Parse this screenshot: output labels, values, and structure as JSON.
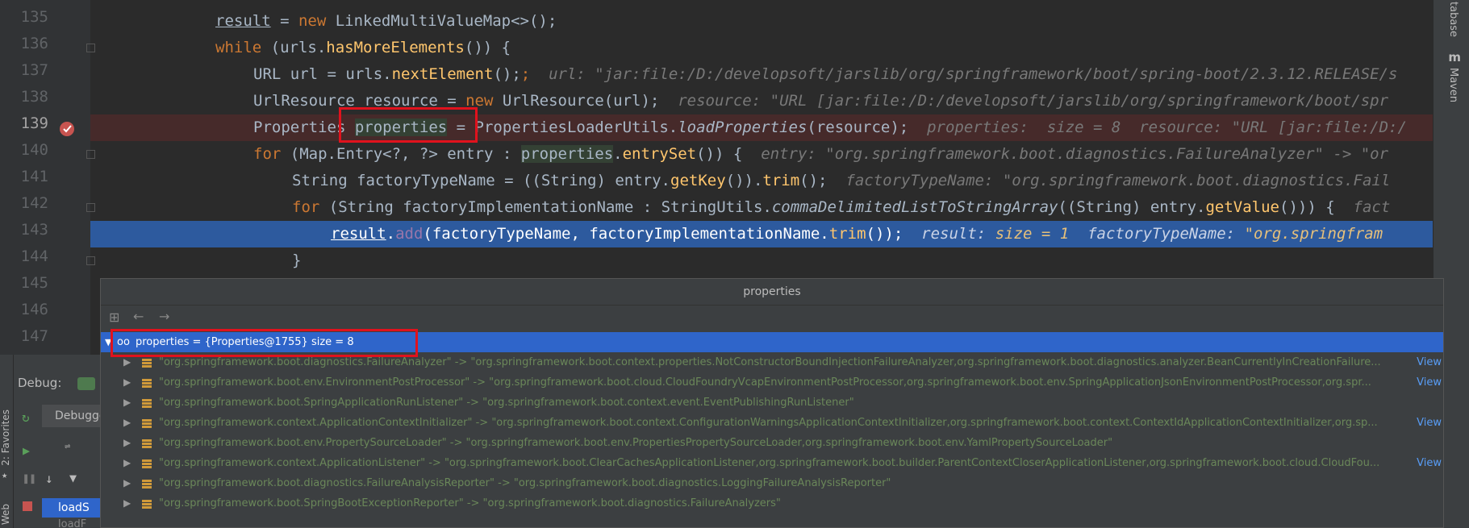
{
  "line_numbers": [
    "135",
    "136",
    "137",
    "138",
    "139",
    "140",
    "141",
    "142",
    "143",
    "144",
    "145",
    "146",
    "147"
  ],
  "code": {
    "l135": {
      "var": "result",
      "op": " = ",
      "kw": "new ",
      "cls": "LinkedMultiValueMap",
      "rest": "<>();"
    },
    "l136": {
      "kw": "while ",
      "rest1": "(urls.",
      "m": "hasMoreElements",
      "rest2": "()) {"
    },
    "l137": {
      "a": "URL url = urls.",
      "m": "nextElement",
      "b": "();",
      "hint": "url: \"jar:file:/D:/developsoft/jarslib/org/springframework/boot/spring-boot/2.3.12.RELEASE/s"
    },
    "l138": {
      "a": "UrlResource resource = ",
      "kw": "new ",
      "b": "UrlResource(url);",
      "hint": "resource: \"URL [jar:file:/D:/developsoft/jarslib/org/springframework/boot/spr"
    },
    "l139": {
      "a": "Properties ",
      "v": "properties",
      "b": " = PropertiesLoaderUtils.",
      "m": "loadProperties",
      "c": "(resource);",
      "hint": "properties:  size = 8  resource: \"URL [jar:file:/D:/"
    },
    "l140": {
      "kw": "for ",
      "a": "(Map.Entry<?, ?> entry : ",
      "v": "properties",
      "b": ".",
      "m": "entrySet",
      "c": "()) {",
      "hint": "entry: \"org.springframework.boot.diagnostics.FailureAnalyzer\" -> \"or"
    },
    "l141": {
      "a": "String factoryTypeName = ((String) entry.",
      "m": "getKey",
      "b": "()).",
      "m2": "trim",
      "c": "();",
      "hint": "factoryTypeName: \"org.springframework.boot.diagnostics.Fail"
    },
    "l142": {
      "kw": "for ",
      "a": "(String factoryImplementationName : StringUtils.",
      "m": "commaDelimitedListToStringArray",
      "b": "((String) entry.",
      "m2": "getValue",
      "c": "())) {",
      "hint": "fact"
    },
    "l143": {
      "v": "result",
      "a": ".",
      "m": "add",
      "b": "(factoryTypeName, factoryImplementationName.",
      "m2": "trim",
      "c": "());",
      "hint1": "result:",
      "hint2": " size = 1",
      "hint3": "factoryTypeName:",
      "hint4": " \"org.springfram"
    },
    "l144": {
      "a": "}"
    }
  },
  "popup": {
    "title": "properties",
    "root": "properties = {Properties@1755}  size = 8",
    "entries": [
      {
        "text": "\"org.springframework.boot.diagnostics.FailureAnalyzer\" -> \"org.springframework.boot.context.properties.NotConstructorBoundInjectionFailureAnalyzer,org.springframework.boot.diagnostics.analyzer.BeanCurrentlyInCreationFailure...",
        "link": "View"
      },
      {
        "text": "\"org.springframework.boot.env.EnvironmentPostProcessor\" -> \"org.springframework.boot.cloud.CloudFoundryVcapEnvironmentPostProcessor,org.springframework.boot.env.SpringApplicationJsonEnvironmentPostProcessor,org.spr...",
        "link": "View"
      },
      {
        "text": "\"org.springframework.boot.SpringApplicationRunListener\" -> \"org.springframework.boot.context.event.EventPublishingRunListener\"",
        "link": ""
      },
      {
        "text": "\"org.springframework.context.ApplicationContextInitializer\" -> \"org.springframework.boot.context.ConfigurationWarningsApplicationContextInitializer,org.springframework.boot.context.ContextIdApplicationContextInitializer,org.sp...",
        "link": "View"
      },
      {
        "text": "\"org.springframework.boot.env.PropertySourceLoader\" -> \"org.springframework.boot.env.PropertiesPropertySourceLoader,org.springframework.boot.env.YamlPropertySourceLoader\"",
        "link": ""
      },
      {
        "text": "\"org.springframework.context.ApplicationListener\" -> \"org.springframework.boot.ClearCachesApplicationListener,org.springframework.boot.builder.ParentContextCloserApplicationListener,org.springframework.boot.cloud.CloudFou...",
        "link": "View"
      },
      {
        "text": "\"org.springframework.boot.diagnostics.FailureAnalysisReporter\" -> \"org.springframework.boot.diagnostics.LoggingFailureAnalysisReporter\"",
        "link": ""
      },
      {
        "text": "\"org.springframework.boot.SpringBootExceptionReporter\" -> \"org.springframework.boot.diagnostics.FailureAnalyzers\"",
        "link": ""
      }
    ]
  },
  "debug": {
    "label": "Debug:",
    "tab": "Debugge",
    "frame1": "loadS",
    "frame2": "loadF"
  },
  "right_tools": {
    "database": "tabase",
    "maven": "Maven"
  },
  "left_tools": {
    "favorites": "2: Favorites",
    "web": "Web"
  },
  "colors": {
    "accent": "#2f65ca",
    "highlight_box": "#e0121d",
    "exec_line": "#2d5a9e"
  }
}
